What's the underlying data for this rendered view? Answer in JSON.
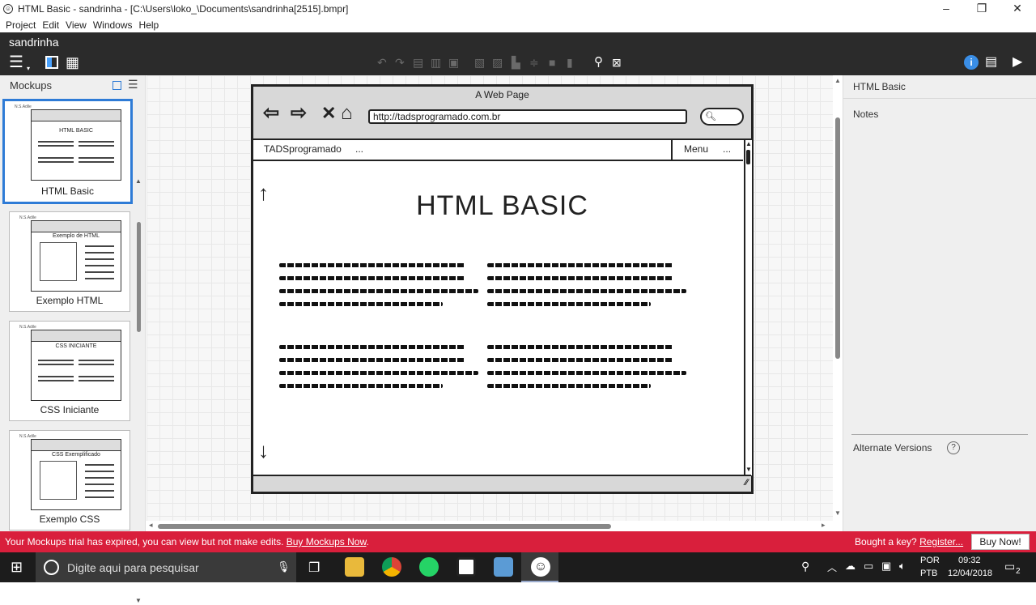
{
  "window": {
    "title": "HTML Basic - sandrinha - [C:\\Users\\loko_\\Documents\\sandrinha[2515].bmpr]",
    "minimize": "–",
    "maximize": "❐",
    "close": "✕"
  },
  "menu": [
    "Project",
    "Edit",
    "View",
    "Windows",
    "Help"
  ],
  "project_name": "sandrinha",
  "left_panel": {
    "header": "Mockups",
    "mockups": [
      {
        "label": "HTML Basic",
        "mini_title": "HTML BASIC",
        "selected": true
      },
      {
        "label": "Exemplo HTML",
        "mini_title": "Exemplo de HTML"
      },
      {
        "label": "CSS Iniciante",
        "mini_title": "CSS INICIANTE"
      },
      {
        "label": "Exemplo CSS",
        "mini_title": "CSS Exemplificado"
      }
    ],
    "mini_project": "N.S.Adile"
  },
  "mockup": {
    "page_title": "A Web Page",
    "url": "http://tadsprogramado.com.br",
    "site_name": "TADSprogramado",
    "ellipsis": "...",
    "menu_label": "Menu",
    "menu_ellipsis": "...",
    "heading": "HTML BASIC"
  },
  "right_panel": {
    "title": "HTML Basic",
    "notes": "Notes",
    "alternate_versions": "Alternate Versions",
    "help": "?"
  },
  "trial_bar": {
    "message": "Your Mockups trial has expired, you can view but not make edits.",
    "link": "Buy Mockups Now",
    "link_suffix": ".",
    "bought": "Bought a key?",
    "register": "Register...",
    "buy_button": "Buy Now!"
  },
  "taskbar": {
    "search_placeholder": "Digite aqui para pesquisar",
    "lang_top": "POR",
    "lang_bottom": "PTB",
    "time": "09:32",
    "date": "12/04/2018",
    "notifications": "2"
  },
  "colors": {
    "accent": "#2e7bd6",
    "trial_bar": "#d91f3c",
    "toolbar_dark": "#2b2b2b",
    "info_icon": "#3a8ee6"
  }
}
